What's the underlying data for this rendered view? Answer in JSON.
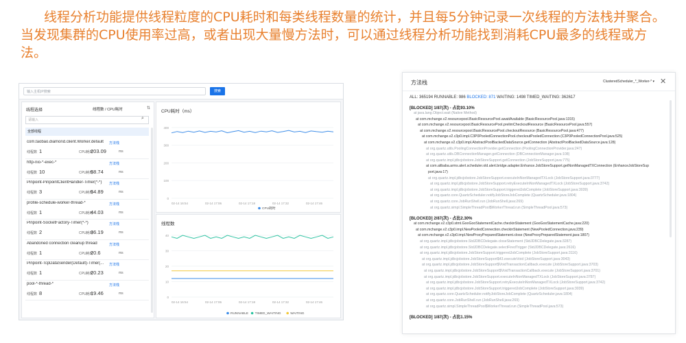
{
  "intro": "线程分析功能提供线程粒度的CPU耗时和每类线程数量的统计，并且每5分钟记录一次线程的方法栈并聚合。当发现集群的CPU使用率过高，或者出现大量慢方法时，可以通过线程分析功能找到消耗CPU最多的线程或方法。",
  "search": {
    "placeholder": "输入主机IP搜索",
    "button": "搜索"
  },
  "thread_panel": {
    "title": "线程选择",
    "sort": "线程数 / CPU耗时",
    "filter_placeholder": "请输入",
    "all_label": "全部线程",
    "count_label": "线程数",
    "cpu_label": "CPU耗时",
    "ms_unit": "ms",
    "stack_link": "方法栈",
    "items": [
      {
        "name": "com.taobao.diamond.client.Worker.default",
        "count": "1",
        "cpu": "203.09"
      },
      {
        "name": "http-nio-*-exec-*",
        "count": "10",
        "cpu": "58.74"
      },
      {
        "name": "Pinpoint-PinpointClientHandler-Timer(*-*)",
        "count": "3",
        "cpu": "54.89"
      },
      {
        "name": "profile-schedule-worker-thread-*",
        "count": "1",
        "cpu": "44.03"
      },
      {
        "name": "Pinpoint-SocketFactory-Timer(*-*)",
        "count": "2",
        "cpu": "36.19"
      },
      {
        "name": "Abandoned connection cleanup thread",
        "count": "1",
        "cpu": "20.6"
      },
      {
        "name": "Pinpoint-TcpDataSender(Default)-Timer(...",
        "count": "1",
        "cpu": "20.23"
      },
      {
        "name": "pool-*-thread-*",
        "count": "8",
        "cpu": "19.46"
      }
    ]
  },
  "chart_data": [
    {
      "type": "line",
      "title": "CPU耗时（ms）",
      "x": [
        "02-14 16:54",
        "02-14 17:06",
        "02-14 17:18",
        "02-14 17:32",
        "02-14 17:46"
      ],
      "ylim": [
        0,
        400
      ],
      "yticks": [
        "0",
        "100",
        "200",
        "300",
        "400"
      ],
      "series": [
        {
          "name": "CPU耗时",
          "color": "#3c8ce8",
          "values": [
            370,
            378,
            372,
            380,
            374,
            381,
            373,
            379,
            375,
            382,
            371,
            377,
            383,
            374,
            379,
            372,
            380,
            376,
            382,
            373,
            378,
            384,
            375,
            379,
            372,
            381,
            377,
            374,
            380,
            376
          ]
        }
      ]
    },
    {
      "type": "line",
      "title": "线程数",
      "x": [
        "02-14 16:54",
        "02-14 17:06",
        "02-14 17:18",
        "02-14 17:32",
        "02-14 17:46"
      ],
      "ylim": [
        0,
        40
      ],
      "yticks": [
        "0",
        "10",
        "20",
        "30",
        "40"
      ],
      "series": [
        {
          "name": "RUNNABLE",
          "color": "#3c8ce8",
          "values": [
            12,
            12,
            12,
            12,
            12,
            12,
            12,
            12,
            12,
            12,
            12,
            12,
            12,
            12,
            12,
            12,
            12,
            12,
            12,
            12,
            12,
            12,
            12,
            12,
            12,
            12,
            12,
            12,
            12,
            12
          ]
        },
        {
          "name": "TIMED_WAITING",
          "color": "#2bc2a0",
          "values": [
            39,
            38,
            40,
            39,
            38,
            39,
            40,
            38,
            39,
            38,
            40,
            39,
            38,
            39,
            38,
            40,
            39,
            38,
            39,
            40,
            38,
            39,
            38,
            40,
            39,
            38,
            39,
            40,
            38,
            39
          ]
        },
        {
          "name": "WAITING",
          "color": "#f2c83a",
          "values": [
            17,
            17,
            17,
            17,
            17,
            17,
            17,
            17,
            17,
            17,
            17,
            17,
            17,
            17,
            17,
            17,
            17,
            17,
            17,
            17,
            17,
            17,
            17,
            17,
            17,
            17,
            17,
            17,
            17,
            17
          ]
        }
      ]
    }
  ],
  "dialog": {
    "title": "方法栈",
    "select": "ClusteredScheduler_*_Worker-* ▾",
    "stats_all": "ALL: 365194  RUNNABLE: 986",
    "stats_blocked": "BLOCKED: 871",
    "stats_rest": "WAITING: 1498  TIMED_WAITING: 362617",
    "lines": [
      {
        "t": "[BLOCKED] 1/87(次) - 占比93.10%",
        "c": "h",
        "i": 0
      },
      {
        "t": "at java.lang.Object.wait (Native Method)",
        "c": "g",
        "i": 0
      },
      {
        "t": "at com.mchange.v2.resourcepool.BasicResourcePool.awaitAvailable (BasicResourcePool.java:1315)",
        "c": "d",
        "i": 1
      },
      {
        "t": "at com.mchange.v2.resourcepool.BasicResourcePool.prelimCheckoutResource (BasicResourcePool.java:557)",
        "c": "d",
        "i": 2
      },
      {
        "t": "at com.mchange.v2.resourcepool.BasicResourcePool.checkoutResource (BasicResourcePool.java:477)",
        "c": "d",
        "i": 3
      },
      {
        "t": "at com.mchange.v2.c3p0.impl.C3P0PooledConnectionPool.checkoutPooledConnection (C3P0PooledConnectionPool.java:525)",
        "c": "d",
        "i": 4
      },
      {
        "t": "at com.mchange.v2.c3p0.impl.AbstractPoolBackedDataSource.getConnection (AbstractPoolBackedDataSource.java:128)",
        "c": "d",
        "i": 5
      },
      {
        "t": "at org.quartz.utils.PoolingConnectionProvider.getConnection (PoolingConnectionProvider.java:247)",
        "c": "g",
        "i": 6
      },
      {
        "t": "at org.quartz.utils.DBConnectionManager.getConnection (DBConnectionManager.java:108)",
        "c": "g",
        "i": 6
      },
      {
        "t": "at org.quartz.impl.jdbcjobstore.JobStoreSupport.getConnection (JobStoreSupport.java:775)",
        "c": "g",
        "i": 6
      },
      {
        "t": "at com.alibaba.arms.alert.scheduler.old.alert.bridge.adapter.Enhance.JobStoreSupport.getNonManagedTXConnection (EnhanceJobStoreSup",
        "c": "d",
        "i": 6
      },
      {
        "t": "port.java:17)",
        "c": "d",
        "i": 7
      },
      {
        "t": "at org.quartz.impl.jdbcjobstore.JobStoreSupport.executeInNonManagedTXLock (JobStoreSupport.java:3777)",
        "c": "g",
        "i": 7
      },
      {
        "t": "at org.quartz.impl.jdbcjobstore.JobStoreSupport.retryExecuteInNonManagedTXLock (JobStoreSupport.java:3742)",
        "c": "g",
        "i": 8
      },
      {
        "t": "at org.quartz.impl.jdbcjobstore.JobStoreSupport.triggeredJobComplete (JobStoreSupport.java:3039)",
        "c": "g",
        "i": 8
      },
      {
        "t": "at org.quartz.core.QuartzScheduler.notifyJobStoreJobComplete (QuartzScheduler.java:1804)",
        "c": "g",
        "i": 8
      },
      {
        "t": "at org.quartz.core.JobRunShell.run (JobRunShell.java:269)",
        "c": "g",
        "i": 8
      },
      {
        "t": "at org.quartz.simpl.SimpleThreadPool$WorkerThread.run (SimpleThreadPool.java:573)",
        "c": "g",
        "i": 8
      },
      {
        "t": "[BLOCKED]  2/87(次) - 占比2.30%",
        "c": "h",
        "i": 0
      },
      {
        "t": "at com.mchange.v2.c3p0.stmt.GooGooStatementCache.checkinStatement (GooGooStatementCache.java:220)",
        "c": "d",
        "i": 0
      },
      {
        "t": "at com.mchange.v2.c3p0.impl.NewPooledConnection.checkinStatement (NewPooledConnection.java:239)",
        "c": "d",
        "i": 1
      },
      {
        "t": "at com.mchange.v2.c3p0.impl.NewProxyPreparedStatement.close (NewProxyPreparedStatement.java:1807)",
        "c": "d",
        "i": 2
      },
      {
        "t": "at org.quartz.impl.jdbcjobstore.StdJDBCDelegate.closeStatement (StdJDBCDelegate.java:3287)",
        "c": "g",
        "i": 3
      },
      {
        "t": "at org.quartz.impl.jdbcjobstore.StdJDBCDelegate.selectFiredTrigger (StdJDBCDelegate.java:2616)",
        "c": "g",
        "i": 3
      },
      {
        "t": "at org.quartz.impl.jdbcjobstore.JobStoreSupport.triggeredJobComplete (JobStoreSupport.java:3116)",
        "c": "g",
        "i": 3
      },
      {
        "t": "at org.quartz.impl.jdbcjobstore.JobStoreSupport$43.executeVoid (JobStoreSupport.java:3043)",
        "c": "g",
        "i": 4
      },
      {
        "t": "at org.quartz.impl.jdbcjobstore.JobStoreSupport$VoidTransactionCallback.execute (JobStoreSupport.java:3703)",
        "c": "g",
        "i": 4
      },
      {
        "t": "at org.quartz.impl.jdbcjobstore.JobStoreSupport$VoidTransactionCallback.execute (JobStoreSupport.java:3701)",
        "c": "g",
        "i": 5
      },
      {
        "t": "at org.quartz.impl.jdbcjobstore.JobStoreSupport.executeInNonManagedTXLock (JobStoreSupport.java:3787)",
        "c": "g",
        "i": 5
      },
      {
        "t": "at org.quartz.impl.jdbcjobstore.JobStoreSupport.retryExecuteInNonManagedTXLock (JobStoreSupport.java:3742)",
        "c": "g",
        "i": 6
      },
      {
        "t": "at org.quartz.impl.jdbcjobstore.JobStoreSupport.triggeredJobComplete (JobStoreSupport.java:3039)",
        "c": "g",
        "i": 6
      },
      {
        "t": "at org.quartz.core.QuartzScheduler.notifyJobStoreJobComplete (QuartzScheduler.java:1804)",
        "c": "g",
        "i": 6
      },
      {
        "t": "at org.quartz.core.JobRunShell.run (JobRunShell.java:269)",
        "c": "g",
        "i": 6
      },
      {
        "t": "at org.quartz.simpl.SimpleThreadPool$WorkerThread.run (SimpleThreadPool.java:573)",
        "c": "g",
        "i": 6
      },
      {
        "t": "[BLOCKED]  1/87(次) - 占比1.15%",
        "c": "h",
        "i": 0
      }
    ]
  }
}
